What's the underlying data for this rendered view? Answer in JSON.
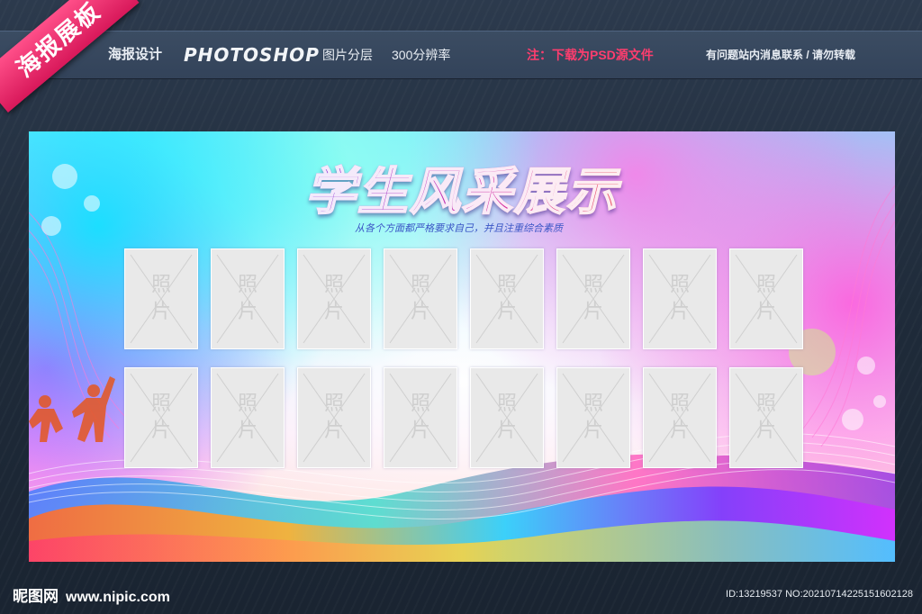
{
  "ribbon": {
    "label": "海报展板"
  },
  "header": {
    "design": "海报设计",
    "software": "PHOTOSHOP",
    "layers": "图片分层",
    "resolution": "300分辨率",
    "note": "注：下载为PSD源文件",
    "contact": "有问题站内消息联系 / 请勿转载"
  },
  "poster": {
    "title": "学生风采展示",
    "subtitle": "从各个方面都严格要求自己，并且注重综合素质",
    "photo_label_1": "照",
    "photo_label_2": "片",
    "rows": 2,
    "cols": 8
  },
  "footer": {
    "site_name": "昵图网",
    "site_url": "www.nipic.com",
    "id_text": "ID:13219537 NO:20210714225151602128"
  },
  "colors": {
    "accent_pink": "#ff3d6e",
    "ribbon": "#e91e63",
    "bar": "#3b4c62"
  }
}
